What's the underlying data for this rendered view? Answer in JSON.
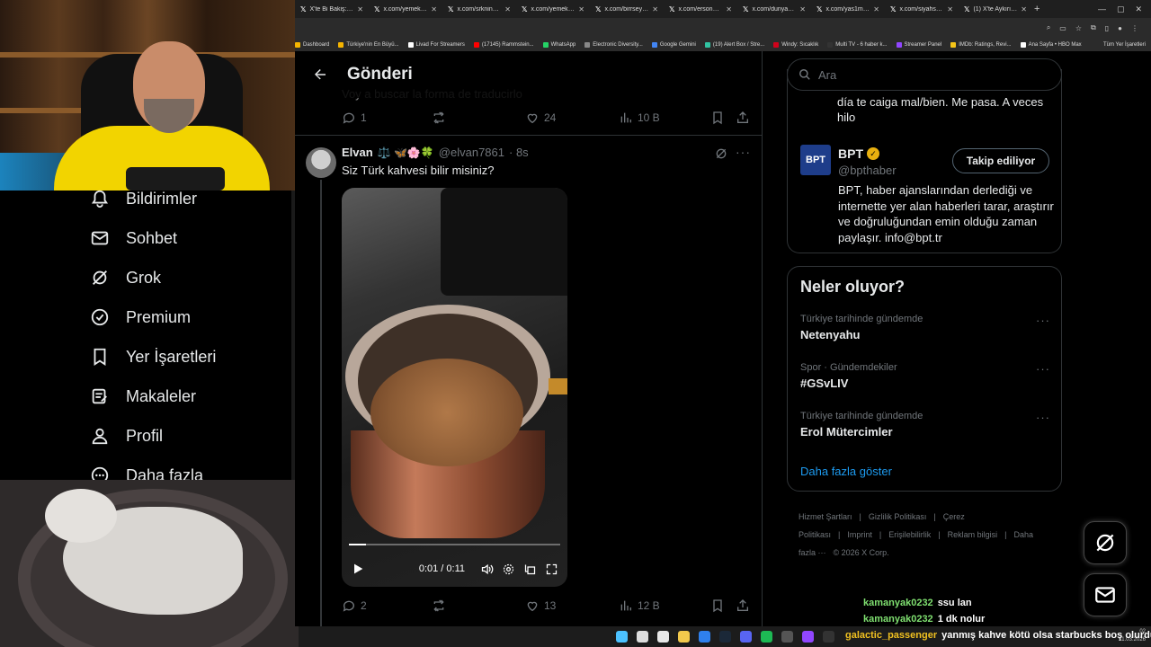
{
  "browser": {
    "tabs": [
      {
        "label": "X'te Bi Bakiş: \"Bin..."
      },
      {
        "label": "x.com/yemekteri..."
      },
      {
        "label": "x.com/srkninci/s..."
      },
      {
        "label": "x.com/yemekten..."
      },
      {
        "label": "x.com/birrseyma..."
      },
      {
        "label": "x.com/ersonhab..."
      },
      {
        "label": "x.com/dunyadan..."
      },
      {
        "label": "x.com/yas1my/st..."
      },
      {
        "label": "x.com/siyahsanc..."
      },
      {
        "label": "(1) X'te Aykırı \"Bi..."
      }
    ],
    "new_tab": "+",
    "bookmarks": [
      {
        "label": "Dashboard",
        "color": "#f5b400"
      },
      {
        "label": "Türkiye'nin En Büyü...",
        "color": "#f5b400"
      },
      {
        "label": "Livad For Streamers",
        "color": "#ffffff"
      },
      {
        "label": "(17145) Rammstein...",
        "color": "#ff0000"
      },
      {
        "label": "WhatsApp",
        "color": "#25d366"
      },
      {
        "label": "Electronic Diversity...",
        "color": "#888888"
      },
      {
        "label": "Google Gemini",
        "color": "#4285f4"
      },
      {
        "label": "(19) Alert Box / Stre...",
        "color": "#31c3a2"
      },
      {
        "label": "Windy: Sıcaklık",
        "color": "#d0021b"
      },
      {
        "label": "Multi TV - 6 haber k...",
        "color": "#333333"
      },
      {
        "label": "Streamer Panel",
        "color": "#9146ff"
      },
      {
        "label": "IMDb: Ratings, Revi...",
        "color": "#f5c518"
      },
      {
        "label": "Ana Sayfa • HBO Max",
        "color": "#ffffff"
      }
    ],
    "all_bookmarks": "Tüm Yer İşaretleri"
  },
  "sidenav": {
    "items": [
      {
        "label": "Bildirimler",
        "icon": "bell-icon"
      },
      {
        "label": "Sohbet",
        "icon": "mail-icon"
      },
      {
        "label": "Grok",
        "icon": "grok-icon"
      },
      {
        "label": "Premium",
        "icon": "verified-icon"
      },
      {
        "label": "Yer İşaretleri",
        "icon": "bookmark-icon"
      },
      {
        "label": "Makaleler",
        "icon": "article-icon"
      },
      {
        "label": "Profil",
        "icon": "profile-icon"
      },
      {
        "label": "Daha fazla",
        "icon": "more-icon"
      }
    ]
  },
  "main": {
    "title": "Gönderi",
    "prev_text": "Voy a buscar la forma de traducirlo",
    "prev_actions": {
      "replies": "1",
      "reposts": "",
      "likes": "24",
      "views": "10 B"
    },
    "tweet": {
      "name": "Elvan",
      "emoji": "⚖️ 🦋🌸🍀",
      "handle": "@elvan7861",
      "time": "· 8s",
      "text": "Siz Türk kahvesi bilir misiniz?",
      "video": {
        "time": "0:01 / 0:11",
        "progress": 0.08
      },
      "actions": {
        "replies": "2",
        "reposts": "",
        "likes": "13",
        "views": "12 B"
      }
    }
  },
  "right": {
    "search_placeholder": "Ara",
    "prev_bio": "día te caiga mal/bien. Me pasa. A veces hilo",
    "bpt": {
      "avatar_text": "BPT",
      "name": "BPT",
      "handle": "@bpthaber",
      "follow_label": "Takip ediliyor",
      "bio": "BPT, haber ajanslarından derlediği ve internette yer alan haberleri tarar, araştırır ve doğruluğundan emin olduğu zaman paylaşır. info@bpt.tr"
    },
    "trends_title": "Neler oluyor?",
    "trends": [
      {
        "meta": "Türkiye tarihinde gündemde",
        "name": "Netenyahu"
      },
      {
        "meta": "Spor · Gündemdekiler",
        "name": "#GSvLIV"
      },
      {
        "meta": "Türkiye tarihinde gündemde",
        "name": "Erol Mütercimler"
      }
    ],
    "show_more": "Daha fazla göster",
    "footer": [
      "Hizmet Şartları",
      "|",
      "Gizlilik Politikası",
      "|",
      "Çerez Politikası",
      "|",
      "Imprint",
      "|",
      "Erişilebilirlik",
      "|",
      "Reklam bilgisi",
      "|",
      "Daha fazla ···",
      "© 2026 X Corp."
    ]
  },
  "chat": [
    {
      "user": "kamanyak0232",
      "msg": "ssu lan",
      "color": "#7fe070"
    },
    {
      "user": "kamanyak0232",
      "msg": "1 dk nolur",
      "color": "#7fe070"
    },
    {
      "user": "galactic_passenger",
      "msg": "yanmış kahve kötü olsa starbucks boş olurdu",
      "color": "#f0c020"
    }
  ],
  "taskbar": {
    "icons": [
      "windows-icon",
      "search-icon",
      "chrome-icon",
      "files-icon",
      "edge-icon",
      "steam-icon",
      "discord-icon",
      "spotify-icon",
      "app-icon",
      "twitch-icon",
      "obs-icon"
    ],
    "clock_time": "02",
    "clock_date": "11.03.2026"
  }
}
